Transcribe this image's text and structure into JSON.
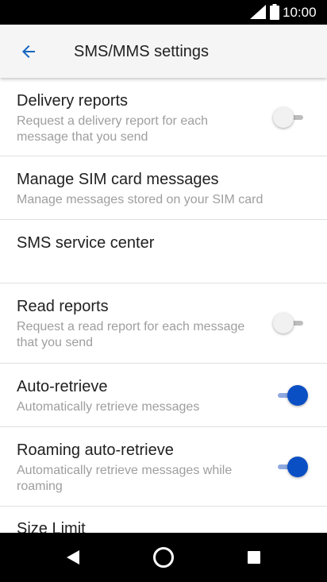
{
  "status_bar": {
    "time": "10:00",
    "icons": [
      "signal-icon",
      "battery-icon"
    ]
  },
  "app_bar": {
    "title": "SMS/MMS settings",
    "back_icon": "arrow-left-icon",
    "accent_color": "#1565c0"
  },
  "settings": [
    {
      "title": "Delivery reports",
      "summary": "Request a delivery report for each message that you send",
      "toggle": false
    },
    {
      "title": "Manage SIM card messages",
      "summary": "Manage messages stored on your SIM card"
    },
    {
      "title": "SMS service center",
      "summary": ""
    },
    {
      "title": "Read reports",
      "summary": "Request a read report for each message that you send",
      "toggle": false
    },
    {
      "title": "Auto-retrieve",
      "summary": "Automatically retrieve messages",
      "toggle": true
    },
    {
      "title": "Roaming auto-retrieve",
      "summary": "Automatically retrieve messages while roaming",
      "toggle": true
    },
    {
      "title": "Size Limit",
      "summary": ""
    }
  ],
  "nav_bar": {
    "icons": [
      "back-triangle-icon",
      "home-circle-icon",
      "recents-square-icon"
    ]
  },
  "colors": {
    "switch_on_thumb": "#0b4fc4",
    "switch_off_thumb": "#f1f1f1",
    "divider": "#e0e0e0"
  }
}
